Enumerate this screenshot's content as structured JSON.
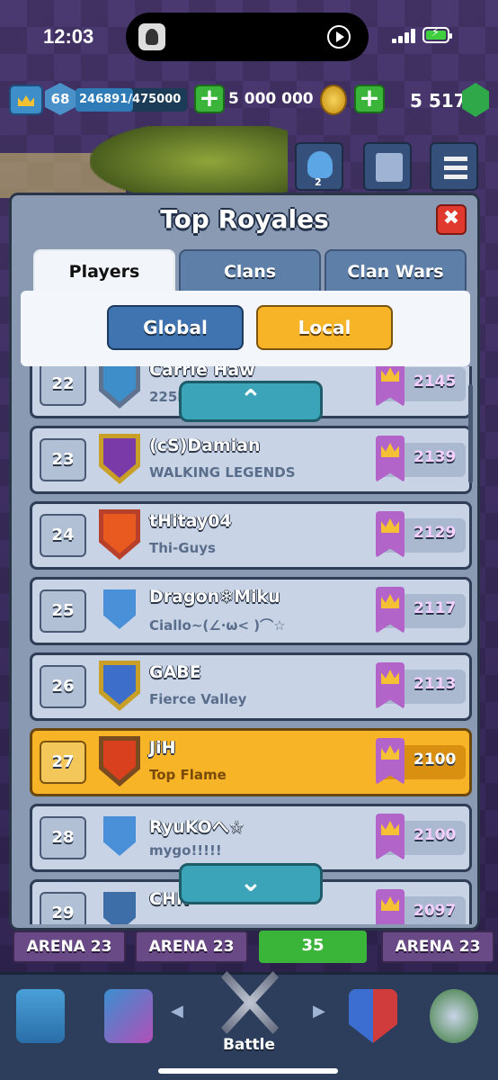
{
  "status": {
    "time": "12:03"
  },
  "header": {
    "level": "68",
    "xp": "246891/475000",
    "xp_progress": 0.52,
    "gold": "5 000 000",
    "gems": "5 517",
    "friends_badge": "2"
  },
  "modal": {
    "title": "Top Royales",
    "close_label": "✖",
    "tabs": [
      "Players",
      "Clans",
      "Clan Wars"
    ],
    "active_tab": "Players",
    "filters": {
      "global": "Global",
      "local": "Local",
      "selected": "Local"
    }
  },
  "leaderboard": [
    {
      "rank": "22",
      "name": "Carrie Haw",
      "clan": "225l...",
      "trophies": "2145",
      "shield_color": "#5f7390",
      "emblem_color": "#3d8ec9"
    },
    {
      "rank": "23",
      "name": "(cS)Damian",
      "clan": "WALKING LEGENDS",
      "trophies": "2139",
      "shield_color": "#c8a028",
      "emblem_color": "#7a3aa8"
    },
    {
      "rank": "24",
      "name": "tHitay04",
      "clan": "Thi-Guys",
      "trophies": "2129",
      "shield_color": "#b8402a",
      "emblem_color": "#e85a20"
    },
    {
      "rank": "25",
      "name": "Dragon❄Miku",
      "clan": "Ciallo~(∠·ω< )⌒☆",
      "trophies": "2117",
      "shield_color": "#c8d4e6",
      "emblem_color": "#4a90d9"
    },
    {
      "rank": "26",
      "name": "GABE",
      "clan": "Fierce Valley",
      "trophies": "2113",
      "shield_color": "#c8a028",
      "emblem_color": "#3d6ec9"
    },
    {
      "rank": "27",
      "name": "JiH",
      "clan": "Top Flame",
      "trophies": "2100",
      "shield_color": "#7a4a20",
      "emblem_color": "#d9401e",
      "is_me": true
    },
    {
      "rank": "28",
      "name": "RyuKOへ☆",
      "clan": "mygo!!!!!",
      "trophies": "2100",
      "shield_color": "#c8d4e6",
      "emblem_color": "#4a90d9"
    },
    {
      "rank": "29",
      "name": "CHN",
      "clan": "...",
      "trophies": "2097",
      "shield_color": "#c8d4e6",
      "emblem_color": "#3d6ea8"
    }
  ],
  "scroll": {
    "up": "⌃",
    "down": "⌄"
  },
  "arenas": {
    "left1": "ARENA 23",
    "left2": "ARENA 23",
    "gems": "35",
    "right": "ARENA 23"
  },
  "nav": {
    "battle_label": "Battle",
    "left_arrow": "◀",
    "right_arrow": "▶"
  }
}
